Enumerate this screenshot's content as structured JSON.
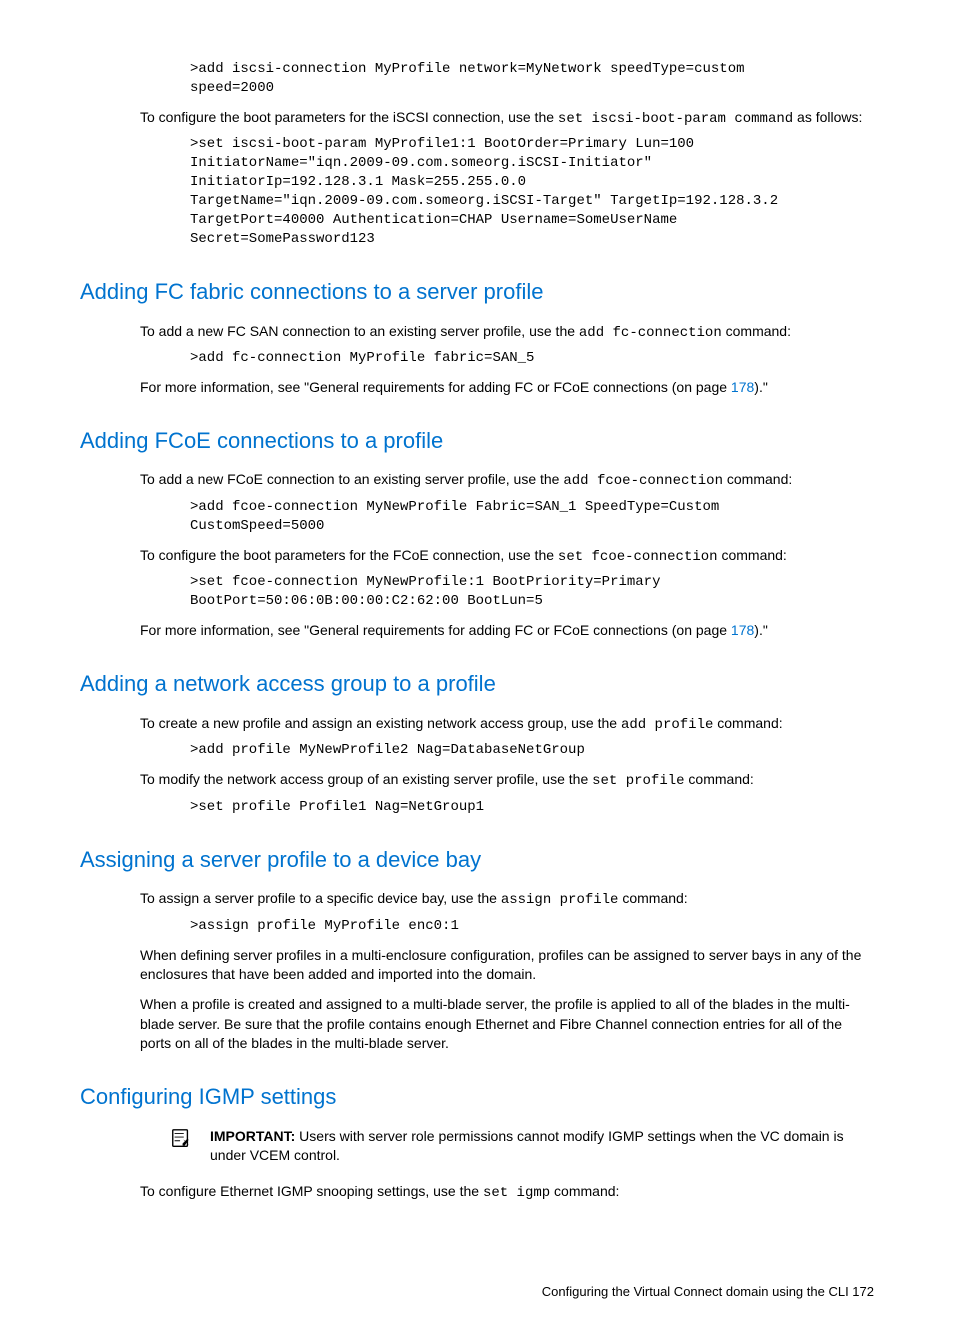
{
  "intro": {
    "code1": ">add iscsi-connection MyProfile network=MyNetwork speedType=custom\nspeed=2000",
    "para1a": "To configure the boot parameters for the iSCSI connection, use the ",
    "cmd1": "set iscsi-boot-param command",
    "para1b": " as follows:",
    "code2": ">set iscsi-boot-param MyProfile1:1 BootOrder=Primary Lun=100\nInitiatorName=\"iqn.2009-09.com.someorg.iSCSI-Initiator\"\nInitiatorIp=192.128.3.1 Mask=255.255.0.0\nTargetName=\"iqn.2009-09.com.someorg.iSCSI-Target\" TargetIp=192.128.3.2\nTargetPort=40000 Authentication=CHAP Username=SomeUserName\nSecret=SomePassword123"
  },
  "sec1": {
    "heading": "Adding FC fabric connections to a server profile",
    "para1a": "To add a new FC SAN connection to an existing server profile, use the ",
    "cmd1": "add fc-connection",
    "para1b": " command:",
    "code1": ">add fc-connection MyProfile fabric=SAN_5",
    "para2a": "For more information, see \"General requirements for adding FC or FCoE connections (on page ",
    "link1": "178",
    "para2b": ").\""
  },
  "sec2": {
    "heading": "Adding FCoE connections to a profile",
    "para1a": "To add a new FCoE connection to an existing server profile, use the ",
    "cmd1": "add fcoe-connection",
    "para1b": " command:",
    "code1": ">add fcoe-connection MyNewProfile Fabric=SAN_1 SpeedType=Custom\nCustomSpeed=5000",
    "para2a": "To configure the boot parameters for the FCoE connection, use the ",
    "cmd2": "set fcoe-connection",
    "para2b": " command:",
    "code2": ">set fcoe-connection MyNewProfile:1 BootPriority=Primary\nBootPort=50:06:0B:00:00:C2:62:00 BootLun=5",
    "para3a": "For more information, see \"General requirements for adding FC or FCoE connections (on page ",
    "link1": "178",
    "para3b": ").\""
  },
  "sec3": {
    "heading": "Adding a network access group to a profile",
    "para1a": "To create a new profile and assign an existing network access group, use the ",
    "cmd1": "add profile",
    "para1b": " command:",
    "code1": ">add profile MyNewProfile2 Nag=DatabaseNetGroup",
    "para2a": "To modify the network access group of an existing server profile, use the ",
    "cmd2": "set profile",
    "para2b": " command:",
    "code2": ">set profile Profile1 Nag=NetGroup1"
  },
  "sec4": {
    "heading": "Assigning a server profile to a device bay",
    "para1a": "To assign a server profile to a specific device bay, use the ",
    "cmd1": "assign profile",
    "para1b": " command:",
    "code1": ">assign profile MyProfile enc0:1",
    "para2": "When defining server profiles in a multi-enclosure configuration, profiles can be assigned to server bays in any of the enclosures that have been added and imported into the domain.",
    "para3": "When a profile is created and assigned to a multi-blade server, the profile is applied to all of the blades in the multi-blade server. Be sure that the profile contains enough Ethernet and Fibre Channel connection entries for all of the ports on all of the blades in the multi-blade server."
  },
  "sec5": {
    "heading": "Configuring IGMP settings",
    "important_label": "IMPORTANT:",
    "important_text": "   Users with server role permissions cannot modify IGMP settings when the VC domain is under VCEM control.",
    "para1a": "To configure Ethernet IGMP snooping settings, use the ",
    "cmd1": "set igmp",
    "para1b": " command:"
  },
  "footer": {
    "text": "Configuring the Virtual Connect domain using the CLI   172"
  }
}
